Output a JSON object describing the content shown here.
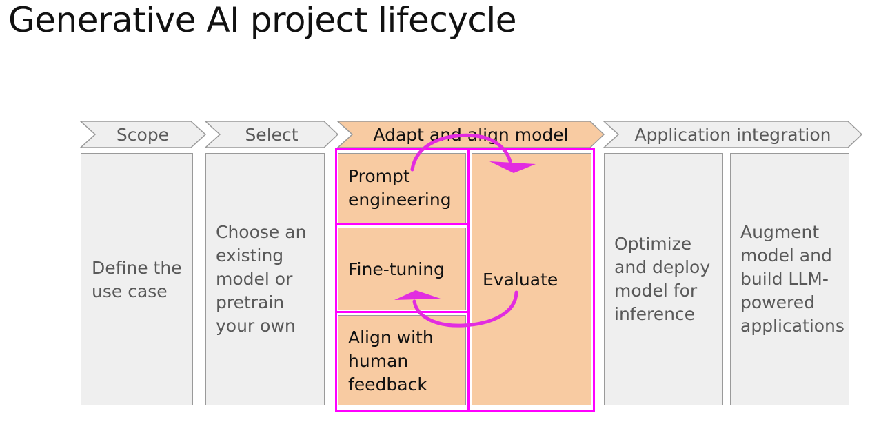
{
  "title": "Generative AI project lifecycle",
  "phases": [
    {
      "label": "Scope"
    },
    {
      "label": "Select"
    },
    {
      "label": "Adapt and align model"
    },
    {
      "label": "Application integration"
    }
  ],
  "steps": {
    "define": [
      "Define the",
      "use case"
    ],
    "choose": [
      "Choose an",
      "existing",
      "model or",
      "pretrain",
      "your own"
    ],
    "prompt": [
      "Prompt",
      "engineering"
    ],
    "finetune": [
      "Fine-tuning"
    ],
    "align": [
      "Align with",
      "human",
      "feedback"
    ],
    "evaluate": [
      "Evaluate"
    ],
    "optimize": [
      "Optimize",
      "and deploy",
      "model for",
      "inference"
    ],
    "augment": [
      "Augment",
      "model and",
      "build LLM-",
      "powered",
      "applications"
    ]
  },
  "colors": {
    "gray_fill": "#efefef",
    "peach_fill": "#f8cba2",
    "highlight": "#ff00ff",
    "border": "#9a9a9a"
  }
}
